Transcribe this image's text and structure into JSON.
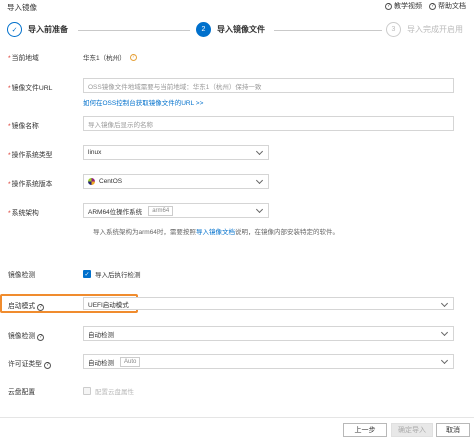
{
  "header": {
    "title": "导入镜像",
    "tutorial_label": "教学视频",
    "help_label": "帮助文档"
  },
  "steps": [
    {
      "number": "✓",
      "label": "导入前准备",
      "state": "done"
    },
    {
      "number": "2",
      "label": "导入镜像文件",
      "state": "active"
    },
    {
      "number": "3",
      "label": "导入完成开启用",
      "state": "todo"
    }
  ],
  "form": {
    "region": {
      "label": "当前地域",
      "value": "华东1（杭州）"
    },
    "image_url": {
      "label": "镜像文件URL",
      "placeholder": "OSS镜像文件地域需要与当前地域：华东1（杭州）保持一致",
      "link": "如何在OSS控制台获取镜像文件的URL >>"
    },
    "image_name": {
      "label": "镜像名称",
      "placeholder": "导入镜像后显示的名称"
    },
    "os_type": {
      "label": "操作系统类型",
      "value": "linux"
    },
    "os_version": {
      "label": "操作系统版本",
      "value": "CentOS"
    },
    "arch": {
      "label": "系统架构",
      "value": "ARM64位操作系统",
      "tag": "arm64"
    },
    "arch_hint": {
      "pre": "导入系统架构为arm64时，需要按照",
      "link": "导入镜像文档",
      "post": "说明，在镜像内部安装特定的软件。"
    },
    "image_check": {
      "label": "镜像检测",
      "option": "导入后执行检测"
    },
    "boot_mode": {
      "label": "启动模式",
      "value": "UEFI启动模式"
    },
    "image_check_mode": {
      "label": "镜像检测",
      "value": "自动检测"
    },
    "license": {
      "label": "许可证类型",
      "value": "自动检测",
      "tag": "Auto"
    },
    "cloud_disk": {
      "label": "云盘配置",
      "option": "配置云盘属性"
    }
  },
  "footer": {
    "prev_label": "上一步",
    "confirm_label": "确定导入",
    "cancel_label": "取消"
  },
  "colors": {
    "accent": "#0070cc",
    "highlight": "#f08c2e",
    "required": "#d93026"
  }
}
